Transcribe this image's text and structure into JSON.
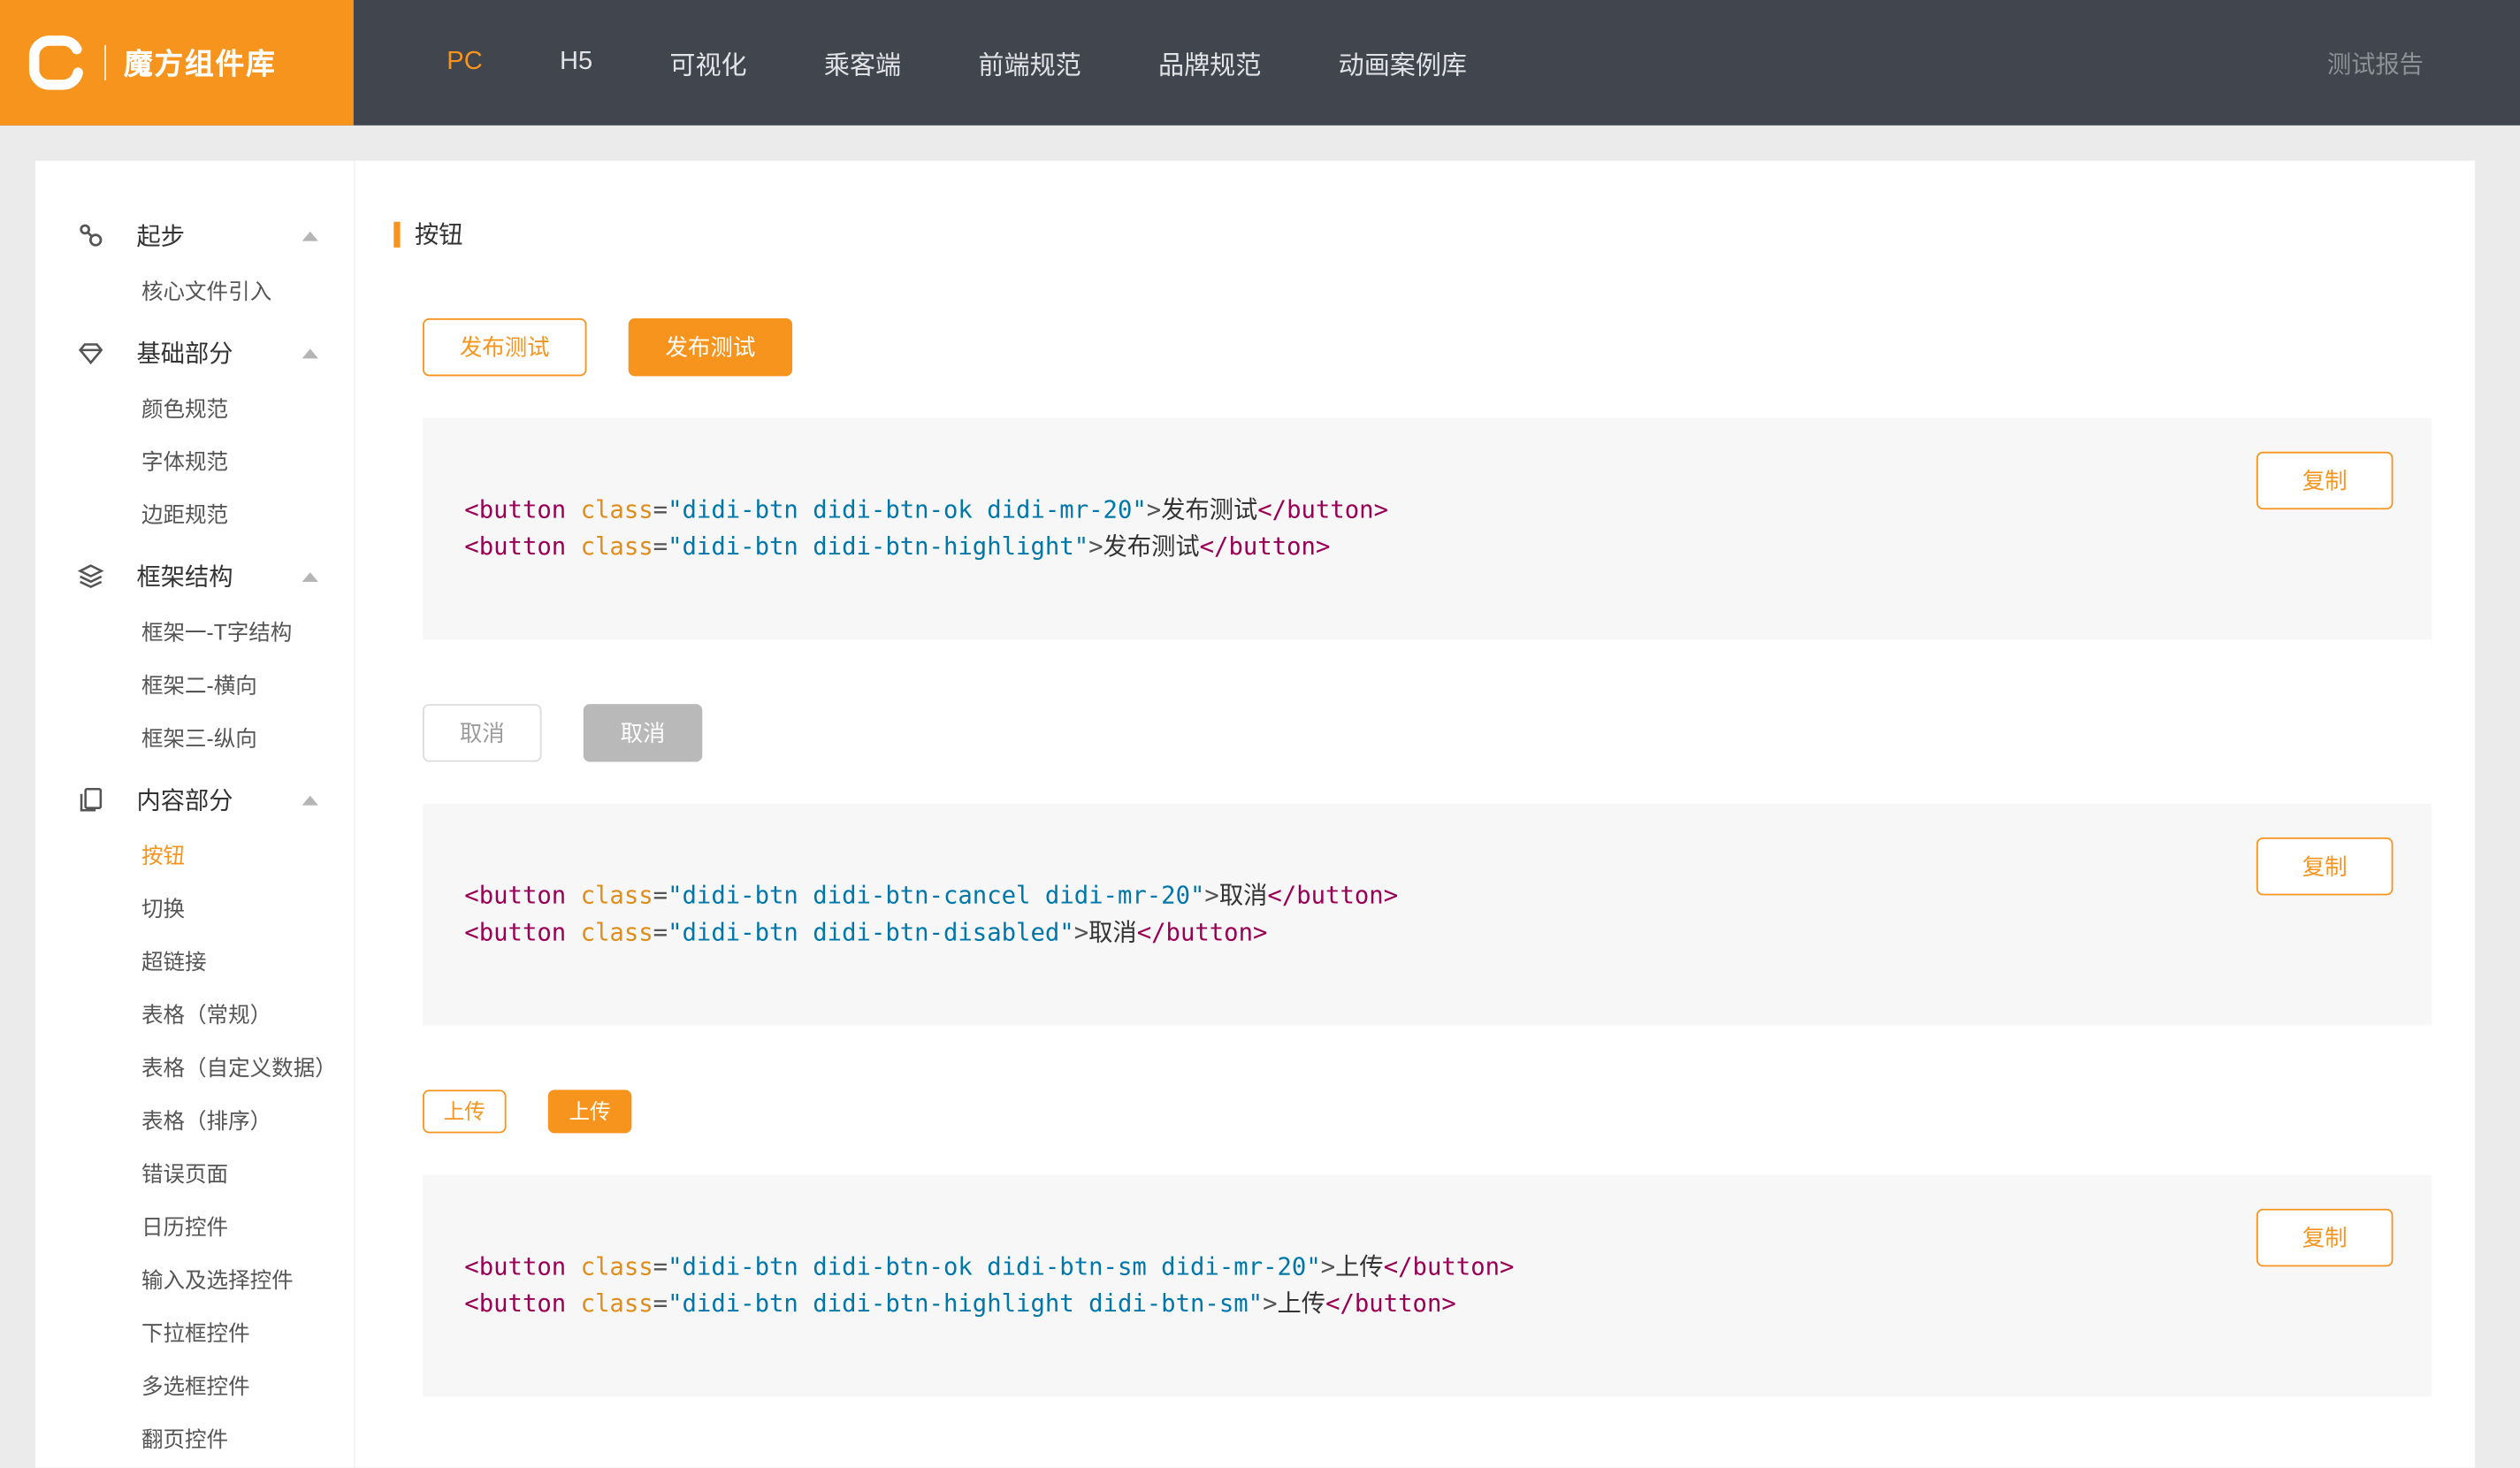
{
  "header": {
    "logo_text": "魔方组件库",
    "nav": [
      {
        "label": "PC",
        "active": true
      },
      {
        "label": "H5"
      },
      {
        "label": "可视化"
      },
      {
        "label": "乘客端"
      },
      {
        "label": "前端规范"
      },
      {
        "label": "品牌规范"
      },
      {
        "label": "动画案例库"
      }
    ],
    "right_link": "测试报告"
  },
  "sidebar": {
    "sections": [
      {
        "icon": "nodes-icon",
        "label": "起步",
        "items": [
          {
            "label": "核心文件引入"
          }
        ]
      },
      {
        "icon": "gem-icon",
        "label": "基础部分",
        "items": [
          {
            "label": "颜色规范"
          },
          {
            "label": "字体规范"
          },
          {
            "label": "边距规范"
          }
        ]
      },
      {
        "icon": "layers-icon",
        "label": "框架结构",
        "items": [
          {
            "label": "框架一-T字结构"
          },
          {
            "label": "框架二-横向"
          },
          {
            "label": "框架三-纵向"
          }
        ]
      },
      {
        "icon": "document-icon",
        "label": "内容部分",
        "items": [
          {
            "label": "按钮",
            "active": true
          },
          {
            "label": "切换"
          },
          {
            "label": "超链接"
          },
          {
            "label": "表格（常规）"
          },
          {
            "label": "表格（自定义数据）"
          },
          {
            "label": "表格（排序）"
          },
          {
            "label": "错误页面"
          },
          {
            "label": "日历控件"
          },
          {
            "label": "输入及选择控件"
          },
          {
            "label": "下拉框控件"
          },
          {
            "label": "多选框控件"
          },
          {
            "label": "翻页控件"
          }
        ]
      }
    ]
  },
  "main": {
    "page_title": "按钮",
    "copy_label": "复制",
    "demos": [
      {
        "buttons": [
          {
            "label": "发布测试",
            "style": "ok"
          },
          {
            "label": "发布测试",
            "style": "highlight"
          }
        ],
        "code": [
          [
            [
              "tag",
              "<button"
            ],
            [
              "attr",
              " class"
            ],
            [
              "pun",
              "="
            ],
            [
              "str",
              "\"didi-btn didi-btn-ok didi-mr-20\""
            ],
            [
              "pun",
              ">"
            ],
            [
              "txt",
              "发布测试"
            ],
            [
              "tag",
              "</button>"
            ]
          ],
          [
            [
              "tag",
              "<button"
            ],
            [
              "attr",
              " class"
            ],
            [
              "pun",
              "="
            ],
            [
              "str",
              "\"didi-btn didi-btn-highlight\""
            ],
            [
              "pun",
              ">"
            ],
            [
              "txt",
              "发布测试"
            ],
            [
              "tag",
              "</button>"
            ]
          ]
        ]
      },
      {
        "buttons": [
          {
            "label": "取消",
            "style": "cancel"
          },
          {
            "label": "取消",
            "style": "disabled"
          }
        ],
        "code": [
          [
            [
              "tag",
              "<button"
            ],
            [
              "attr",
              " class"
            ],
            [
              "pun",
              "="
            ],
            [
              "str",
              "\"didi-btn didi-btn-cancel didi-mr-20\""
            ],
            [
              "pun",
              ">"
            ],
            [
              "txt",
              "取消"
            ],
            [
              "tag",
              "</button>"
            ]
          ],
          [
            [
              "tag",
              "<button"
            ],
            [
              "attr",
              " class"
            ],
            [
              "pun",
              "="
            ],
            [
              "str",
              "\"didi-btn didi-btn-disabled\""
            ],
            [
              "pun",
              ">"
            ],
            [
              "txt",
              "取消"
            ],
            [
              "tag",
              "</button>"
            ]
          ]
        ]
      },
      {
        "buttons": [
          {
            "label": "上传",
            "style": "ok",
            "small": true
          },
          {
            "label": "上传",
            "style": "highlight",
            "small": true
          }
        ],
        "code": [
          [
            [
              "tag",
              "<button"
            ],
            [
              "attr",
              " class"
            ],
            [
              "pun",
              "="
            ],
            [
              "str",
              "\"didi-btn didi-btn-ok didi-btn-sm didi-mr-20\""
            ],
            [
              "pun",
              ">"
            ],
            [
              "txt",
              "上传"
            ],
            [
              "tag",
              "</button>"
            ]
          ],
          [
            [
              "tag",
              "<button"
            ],
            [
              "attr",
              " class"
            ],
            [
              "pun",
              "="
            ],
            [
              "str",
              "\"didi-btn didi-btn-highlight didi-btn-sm\""
            ],
            [
              "pun",
              ">"
            ],
            [
              "txt",
              "上传"
            ],
            [
              "tag",
              "</button>"
            ]
          ]
        ]
      }
    ]
  },
  "colors": {
    "accent": "#f7941e",
    "header-bg": "#41454e",
    "page-bg": "#ebebeb",
    "code-bg": "#f7f7f7",
    "code-tag": "#990055",
    "code-attr": "#e08e1b",
    "code-str": "#0077aa",
    "code-pun": "#555555",
    "code-txt": "#333333",
    "cancel-border": "#dcdcdc",
    "cancel-text": "#9b9b9b",
    "disabled-bg": "#b9b9b9"
  }
}
